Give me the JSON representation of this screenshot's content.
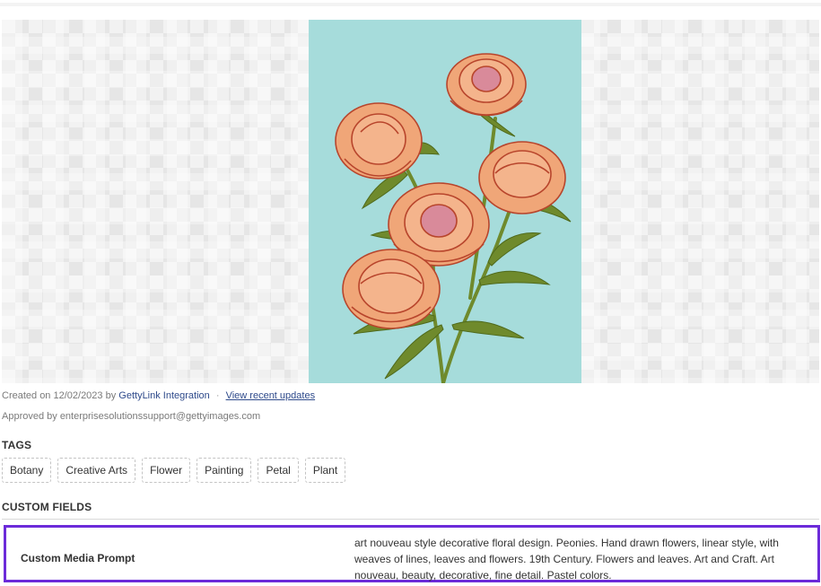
{
  "meta": {
    "created_prefix": "Created on 12/02/2023 by",
    "created_author": "GettyLink Integration",
    "separator": "·",
    "recent_updates_link": "View recent updates",
    "approved": "Approved by enterprisesolutionssupport@gettyimages.com"
  },
  "tags": {
    "title": "TAGS",
    "items": [
      "Botany",
      "Creative Arts",
      "Flower",
      "Painting",
      "Petal",
      "Plant"
    ]
  },
  "custom_fields": {
    "title": "CUSTOM FIELDS",
    "rows": [
      {
        "label": "Custom Media Prompt",
        "value": "art nouveau style decorative floral design. Peonies. Hand drawn flowers, linear style, with weaves of lines, leaves and flowers. 19th Century. Flowers and leaves. Art and Craft. Art nouveau, beauty, decorative, fine detail. Pastel colors."
      }
    ]
  },
  "colors": {
    "artwork_background": "#a6dcdb",
    "petal": "#f0a678",
    "petal_outline": "#b8452c",
    "leaf": "#6f8a2c",
    "highlight_border": "#6c2bd9",
    "link": "#2e4a8b"
  }
}
